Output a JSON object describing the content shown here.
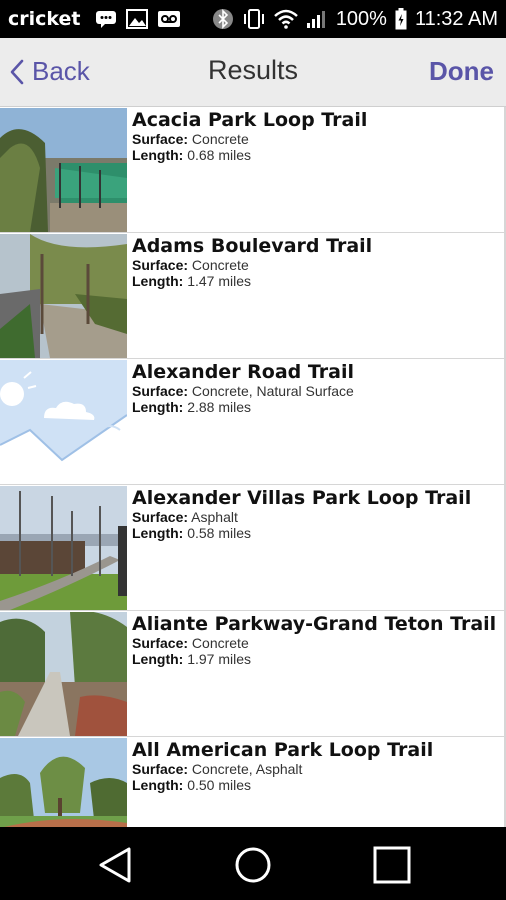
{
  "status_bar": {
    "carrier": "cricket",
    "battery": "100%",
    "time": "11:32 AM"
  },
  "nav": {
    "back_label": "Back",
    "title": "Results",
    "done_label": "Done"
  },
  "labels": {
    "surface": "Surface:",
    "length": "Length:"
  },
  "trails": [
    {
      "name": "Acacia Park Loop Trail",
      "surface": "Concrete",
      "length": "0.68 miles"
    },
    {
      "name": "Adams Boulevard Trail",
      "surface": "Concrete",
      "length": "1.47 miles"
    },
    {
      "name": "Alexander Road Trail",
      "surface": "Concrete, Natural Surface",
      "length": "2.88 miles"
    },
    {
      "name": "Alexander Villas Park Loop Trail",
      "surface": "Asphalt",
      "length": "0.58 miles"
    },
    {
      "name": "Aliante Parkway-Grand Teton Trail",
      "surface": "Concrete",
      "length": "1.97 miles"
    },
    {
      "name": "All American Park Loop Trail",
      "surface": "Concrete, Asphalt",
      "length": "0.50 miles"
    }
  ],
  "colors": {
    "accent": "#5a55a8",
    "nav_bg": "#ececec",
    "system_bar": "#000000"
  }
}
